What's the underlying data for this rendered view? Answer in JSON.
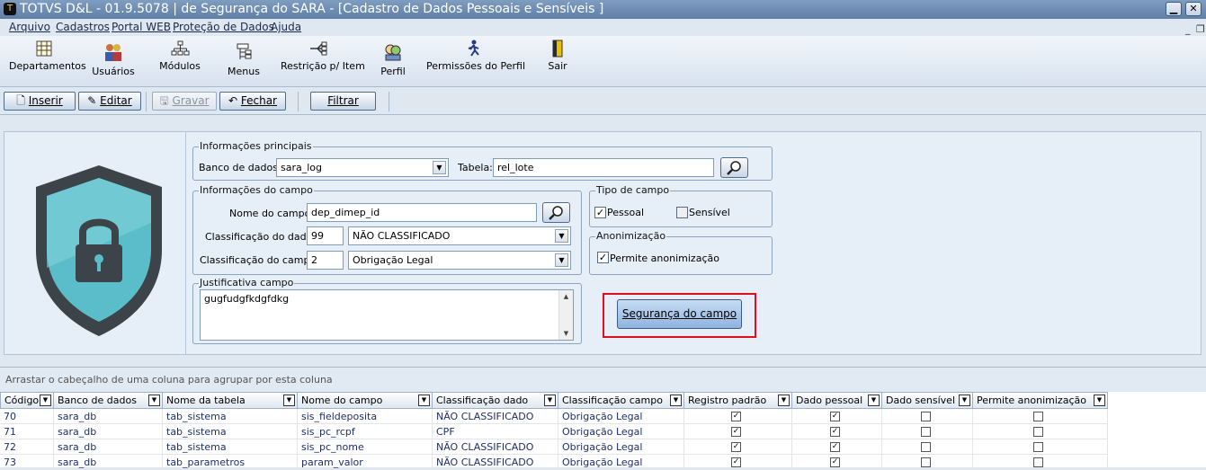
{
  "window": {
    "title": "TOTVS D&L - 01.9.5078 | de Segurança do SARA - [Cadastro de Dados Pessoais e Sensíveis ]",
    "minimize_label": "▁",
    "close_label": "✕"
  },
  "menu": {
    "items": [
      "Arquivo",
      "Cadastros",
      "Portal WEB",
      "Proteção de Dados",
      "Ajuda"
    ],
    "mdi_minimize": "_",
    "mdi_restore": "❐"
  },
  "ribbon": {
    "buttons": [
      {
        "label": "Departamentos",
        "icon": "grid-icon"
      },
      {
        "label": "Usuários",
        "icon": "users-icon"
      },
      {
        "label": "Módulos",
        "icon": "modules-icon"
      },
      {
        "label": "Menus",
        "icon": "menu-tree-icon"
      },
      {
        "label": "Restrição p/ Item",
        "icon": "restriction-icon"
      },
      {
        "label": "Perfil",
        "icon": "profile-icon"
      },
      {
        "label": "Permissões do Perfil",
        "icon": "permission-icon"
      },
      {
        "label": "Sair",
        "icon": "exit-door-icon"
      }
    ]
  },
  "toolbar": {
    "insert_label": "Inserir",
    "edit_label": "Editar",
    "save_label": "Gravar",
    "close_label": "Fechar",
    "filter_label": "Filtrar"
  },
  "form": {
    "main_info": {
      "title": "Informações principais",
      "db_label": "Banco de dados:",
      "db_value": "sara_log",
      "table_label": "Tabela:",
      "table_value": "rel_lote"
    },
    "field_info": {
      "title": "Informações do campo",
      "field_name_label": "Nome do campo:",
      "field_name_value": "dep_dimep_id",
      "data_class_label": "Classificação do dado:",
      "data_class_code": "99",
      "data_class_value": "NÃO CLASSIFICADO",
      "field_class_label": "Classificação do campo:",
      "field_class_code": "2",
      "field_class_value": "Obrigação Legal"
    },
    "field_type": {
      "title": "Tipo de campo",
      "personal_label": "Pessoal",
      "personal_checked": true,
      "sensitive_label": "Sensível",
      "sensitive_checked": false
    },
    "anonymization": {
      "title": "Anonimização",
      "allow_label": "Permite anonimização",
      "allow_checked": true
    },
    "justification": {
      "title": "Justificativa campo",
      "value": "gugfudgfkdgfdkg"
    },
    "security_button_label": "Segurança do campo"
  },
  "grid": {
    "group_hint": "Arrastar o cabeçalho de uma coluna para agrupar por esta coluna",
    "columns": [
      "Código",
      "Banco de dados",
      "Nome da tabela",
      "Nome do campo",
      "Classificação dado",
      "Classificação campo",
      "Registro padrão",
      "Dado pessoal",
      "Dado sensível",
      "Permite anonimização"
    ],
    "rows": [
      {
        "code": "70",
        "db": "sara_db",
        "table": "tab_sistema",
        "field": "sis_fieldeposita",
        "data_class": "NÃO CLASSIFICADO",
        "field_class": "Obrigação Legal",
        "default": true,
        "personal": true,
        "sensitive": false,
        "anonymize": false
      },
      {
        "code": "71",
        "db": "sara_db",
        "table": "tab_sistema",
        "field": "sis_pc_rcpf",
        "data_class": "CPF",
        "field_class": "Obrigação Legal",
        "default": true,
        "personal": true,
        "sensitive": false,
        "anonymize": false
      },
      {
        "code": "72",
        "db": "sara_db",
        "table": "tab_sistema",
        "field": "sis_pc_nome",
        "data_class": "NÃO CLASSIFICADO",
        "field_class": "Obrigação Legal",
        "default": true,
        "personal": true,
        "sensitive": false,
        "anonymize": false
      },
      {
        "code": "73",
        "db": "sara_db",
        "table": "tab_parametros",
        "field": "param_valor",
        "data_class": "NÃO CLASSIFICADO",
        "field_class": "Obrigação Legal",
        "default": true,
        "personal": true,
        "sensitive": false,
        "anonymize": false
      }
    ]
  },
  "colors": {
    "accent": "#5f7fa6",
    "highlight_border": "#e0101a",
    "shield_teal": "#5bbdc9",
    "shield_dark": "#3d4449"
  }
}
